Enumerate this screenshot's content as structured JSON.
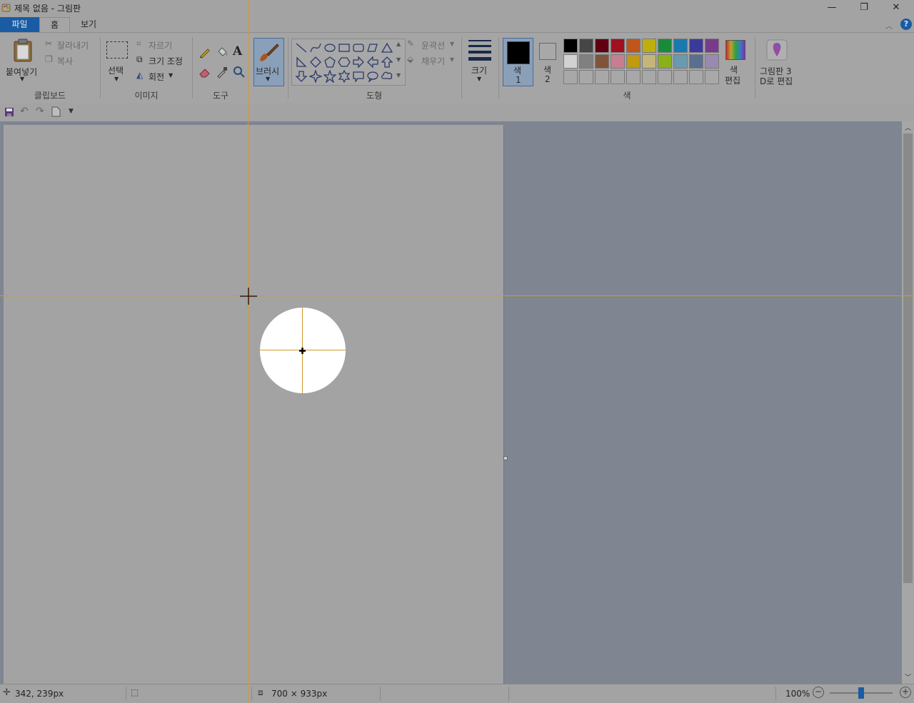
{
  "window": {
    "title": "제목 없음 - 그림판",
    "minimize_glyph": "—",
    "restore_glyph": "❐",
    "close_glyph": "✕"
  },
  "tabs": {
    "file": "파일",
    "home": "홈",
    "view": "보기"
  },
  "ribbon": {
    "clipboard": {
      "label": "클립보드",
      "paste": "붙여넣기",
      "cut": "잘라내기",
      "copy": "복사"
    },
    "image": {
      "label": "이미지",
      "select": "선택",
      "crop": "자르기",
      "resize": "크기 조정",
      "rotate": "회전"
    },
    "tools": {
      "label": "도구"
    },
    "brushes": {
      "label": "브러시"
    },
    "shapes": {
      "label": "도형",
      "outline": "윤곽선",
      "fill": "채우기"
    },
    "size": {
      "label": "크기"
    },
    "colors": {
      "label": "색",
      "color1_line1": "색",
      "color1_line2": "1",
      "color2_line1": "색",
      "color2_line2": "2",
      "edit_line1": "색",
      "edit_line2": "편집",
      "paint3d_line1": "그림판 3",
      "paint3d_line2": "D로 편집",
      "color1_value": "#000000",
      "color2_value": "#ffffff",
      "palette_row1": [
        "#000000",
        "#464646",
        "#600012",
        "#a01020",
        "#c0561a",
        "#bfae10",
        "#1a8a3a",
        "#1a7ab0",
        "#3a3a9a",
        "#7a3a8a"
      ],
      "palette_row2": [
        "#d2d2d2",
        "#808080",
        "#80543a",
        "#c87e90",
        "#c09a10",
        "#c4b678",
        "#8ab01a",
        "#6a9ab0",
        "#5a6e90",
        "#9a8ab0"
      ]
    }
  },
  "status": {
    "cursor_position": "342, 239px",
    "canvas_size": "700 × 933px",
    "zoom": "100%"
  }
}
